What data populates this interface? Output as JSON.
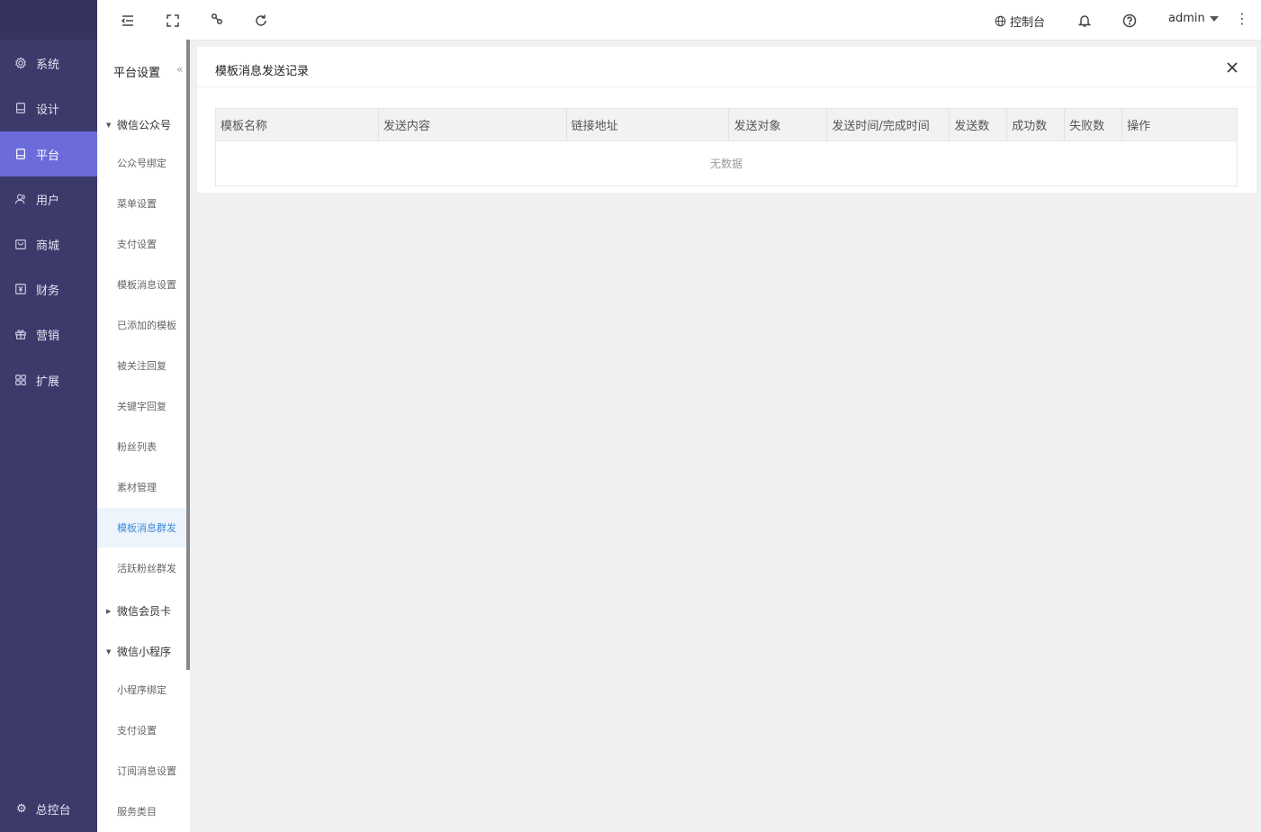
{
  "leftnav": {
    "items": [
      {
        "label": "系统",
        "icon": "gear-icon"
      },
      {
        "label": "设计",
        "icon": "design-icon"
      },
      {
        "label": "平台",
        "icon": "platform-icon"
      },
      {
        "label": "用户",
        "icon": "user-icon"
      },
      {
        "label": "商城",
        "icon": "shop-icon"
      },
      {
        "label": "财务",
        "icon": "finance-icon"
      },
      {
        "label": "营销",
        "icon": "gift-icon"
      },
      {
        "label": "扩展",
        "icon": "grid-icon"
      }
    ],
    "active": "平台",
    "bottom_label": "总控台"
  },
  "subnav": {
    "title": "平台设置",
    "collapse_glyph": "«",
    "groups": [
      {
        "label": "微信公众号",
        "expanded": true
      },
      {
        "label": "微信会员卡",
        "expanded": false
      },
      {
        "label": "微信小程序",
        "expanded": true
      }
    ],
    "items": [
      "公众号绑定",
      "菜单设置",
      "支付设置",
      "模板消息设置",
      "已添加的模板",
      "被关注回复",
      "关键字回复",
      "粉丝列表",
      "素材管理",
      "模板消息群发",
      "活跃粉丝群发",
      "小程序绑定",
      "支付设置",
      "订阅消息设置",
      "服务类目"
    ],
    "active_item": "模板消息群发"
  },
  "header": {
    "console_label": "控制台",
    "username": "admin"
  },
  "card": {
    "title": "模板消息发送记录",
    "columns": [
      "模板名称",
      "发送内容",
      "链接地址",
      "发送对象",
      "发送时间/完成时间",
      "发送数",
      "成功数",
      "失败数",
      "操作"
    ],
    "empty_text": "无数据"
  },
  "colors": {
    "nav_bg": "#3b3a6b",
    "nav_active": "#6b6bdb",
    "sub_active_text": "#3d8bd9"
  }
}
